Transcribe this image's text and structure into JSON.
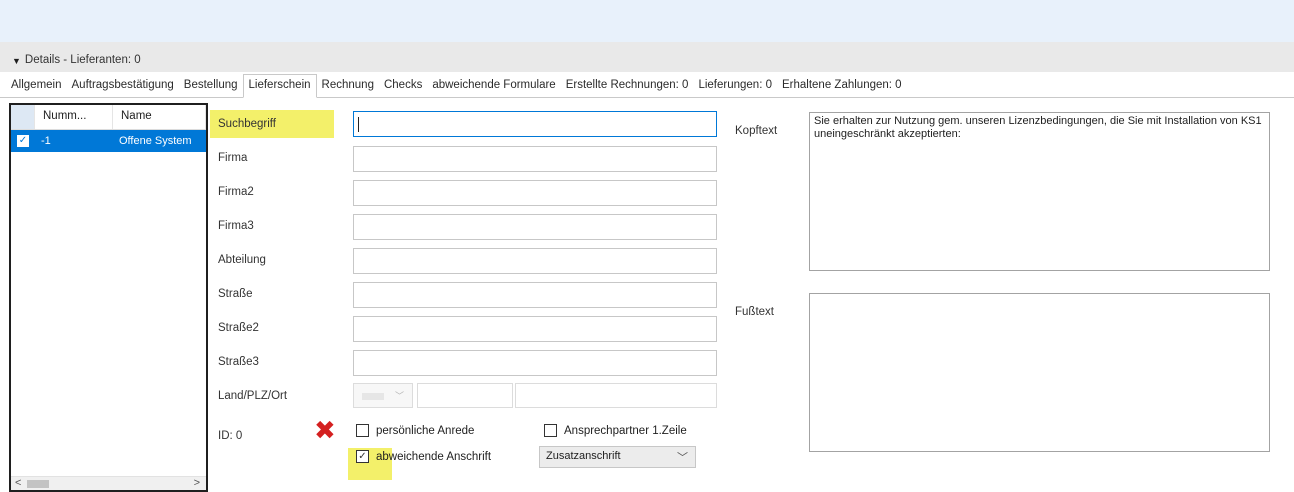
{
  "section": {
    "title": "Details - Lieferanten: 0"
  },
  "tabs": [
    {
      "label": "Allgemein"
    },
    {
      "label": "Auftragsbestätigung"
    },
    {
      "label": "Bestellung"
    },
    {
      "label": "Lieferschein"
    },
    {
      "label": "Rechnung"
    },
    {
      "label": "Checks"
    },
    {
      "label": "abweichende Formulare"
    },
    {
      "label": "Erstellte Rechnungen: 0"
    },
    {
      "label": "Lieferungen: 0"
    },
    {
      "label": "Erhaltene Zahlungen: 0"
    }
  ],
  "active_tab": "Lieferschein",
  "list": {
    "headers": {
      "num": "Numm...",
      "name": "Name"
    },
    "rows": [
      {
        "checked": true,
        "num": "-1",
        "name": "Offene System"
      }
    ]
  },
  "form": {
    "labels": {
      "suchbegriff": "Suchbegriff",
      "firma": "Firma",
      "firma2": "Firma2",
      "firma3": "Firma3",
      "abteilung": "Abteilung",
      "strasse": "Straße",
      "strasse2": "Straße2",
      "strasse3": "Straße3",
      "land_plz_ort": "Land/PLZ/Ort",
      "id": "ID: 0"
    },
    "checkboxes": {
      "persoenliche_anrede": {
        "label": "persönliche Anrede",
        "checked": false
      },
      "ansprechpartner": {
        "label": "Ansprechpartner 1.Zeile",
        "checked": false
      },
      "abweichende_anschrift": {
        "label": "abweichende Anschrift",
        "checked": true
      }
    },
    "anschrift_select": {
      "value": "Zusatzanschrift"
    }
  },
  "kopftext": {
    "label": "Kopftext",
    "value": "Sie erhalten zur Nutzung gem. unseren Lizenzbedingungen, die Sie mit Installation von KS1 uneingeschränkt akzeptierten:"
  },
  "fusstext": {
    "label": "Fußtext",
    "value": ""
  },
  "icons": {
    "collapse": "collapse-arrow-icon",
    "checked_row": "checkbox-checked-icon",
    "annotation": "red-x-icon",
    "dropdown": "chevron-down-icon"
  },
  "colors": {
    "selection": "#0078d7",
    "highlight": "#f3f06a",
    "annotation_red": "#d42020",
    "focus_border": "#0078d7"
  }
}
